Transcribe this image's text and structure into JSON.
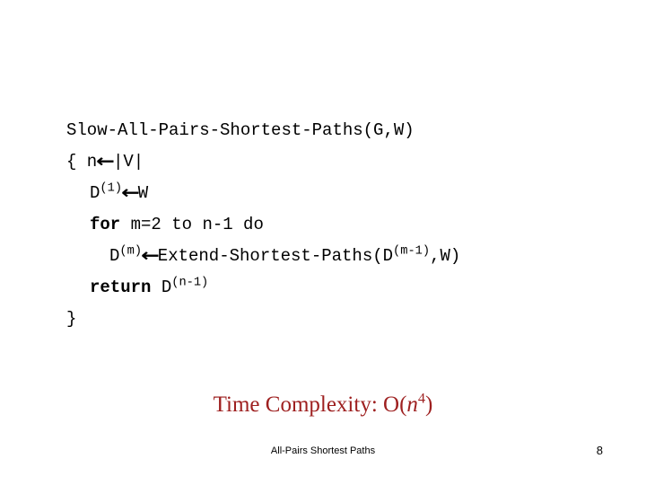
{
  "slide": {
    "background_color": "#ffffff",
    "text_color": "#000000",
    "accent_color": "#9e2020"
  },
  "code": {
    "line1": {
      "signature": "Slow-All-Pairs-Shortest-Paths(G,W)"
    },
    "line2": {
      "open_brace": "{ n",
      "arrow": "←",
      "value": "|V|"
    },
    "line3": {
      "target": "D",
      "superscript": "(1)",
      "arrow": "←",
      "value": "W"
    },
    "line4": {
      "keyword": "for",
      "rest": "m=2 to n-1 do"
    },
    "line5": {
      "target": "D",
      "superscript": "(m)",
      "arrow": "←",
      "call_prefix": "Extend-Shortest-Paths(D",
      "call_superscript": "(m-1)",
      "call_suffix": ",W)"
    },
    "line6": {
      "keyword": "return",
      "target": "D",
      "superscript": "(n-1)"
    },
    "line7": {
      "close_brace": "}"
    }
  },
  "complexity": {
    "label": "Time Complexity: O(",
    "variable": "n",
    "exponent": "4",
    "close": ")"
  },
  "footer": {
    "title": "All-Pairs Shortest Paths",
    "page_number": "8"
  }
}
